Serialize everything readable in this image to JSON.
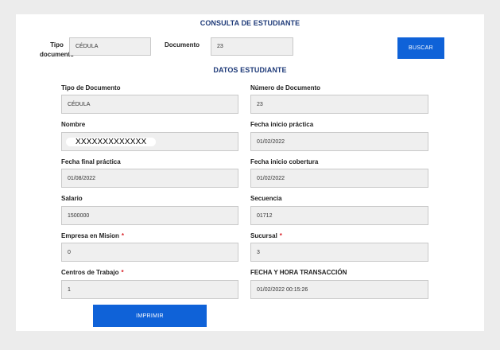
{
  "consulta": {
    "title": "CONSULTA DE ESTUDIANTE",
    "tipo_label_line1": "Tipo",
    "tipo_label_line2": "documento",
    "tipo_value": "CÉDULA",
    "documento_label": "Documento",
    "documento_value": "23",
    "buscar_label": "BUSCAR"
  },
  "datos": {
    "title": "DATOS ESTUDIANTE",
    "tipo_documento": {
      "label": "Tipo de Documento",
      "value": "CÉDULA"
    },
    "numero_documento": {
      "label": "Número de Documento",
      "value": "23"
    },
    "nombre": {
      "label": "Nombre",
      "value": "XXXXXXXXXXXXX"
    },
    "fecha_inicio_practica": {
      "label": "Fecha inicio práctica",
      "value": "01/02/2022"
    },
    "fecha_final_practica": {
      "label": "Fecha final práctica",
      "value": "01/08/2022"
    },
    "fecha_inicio_cobertura": {
      "label": "Fecha inicio cobertura",
      "value": "01/02/2022"
    },
    "salario": {
      "label": "Salario",
      "value": "1500000"
    },
    "secuencia": {
      "label": "Secuencia",
      "value": "01712"
    },
    "empresa_mision": {
      "label": "Empresa en Mision",
      "required": "*",
      "value": "0"
    },
    "sucursal": {
      "label": "Sucursal",
      "required": "*",
      "value": "3"
    },
    "centros_trabajo": {
      "label": "Centros de Trabajo",
      "required": "*",
      "value": "1"
    },
    "fecha_hora": {
      "label": "FECHA Y HORA TRANSACCIÓN",
      "value": "01/02/2022 00:15:26"
    }
  },
  "imprimir_label": "IMPRIMIR",
  "colors": {
    "accent": "#0f62d8",
    "title": "#1e3a78",
    "required": "#d81f26",
    "field_bg": "#efefef",
    "page_bg": "#ececec"
  }
}
